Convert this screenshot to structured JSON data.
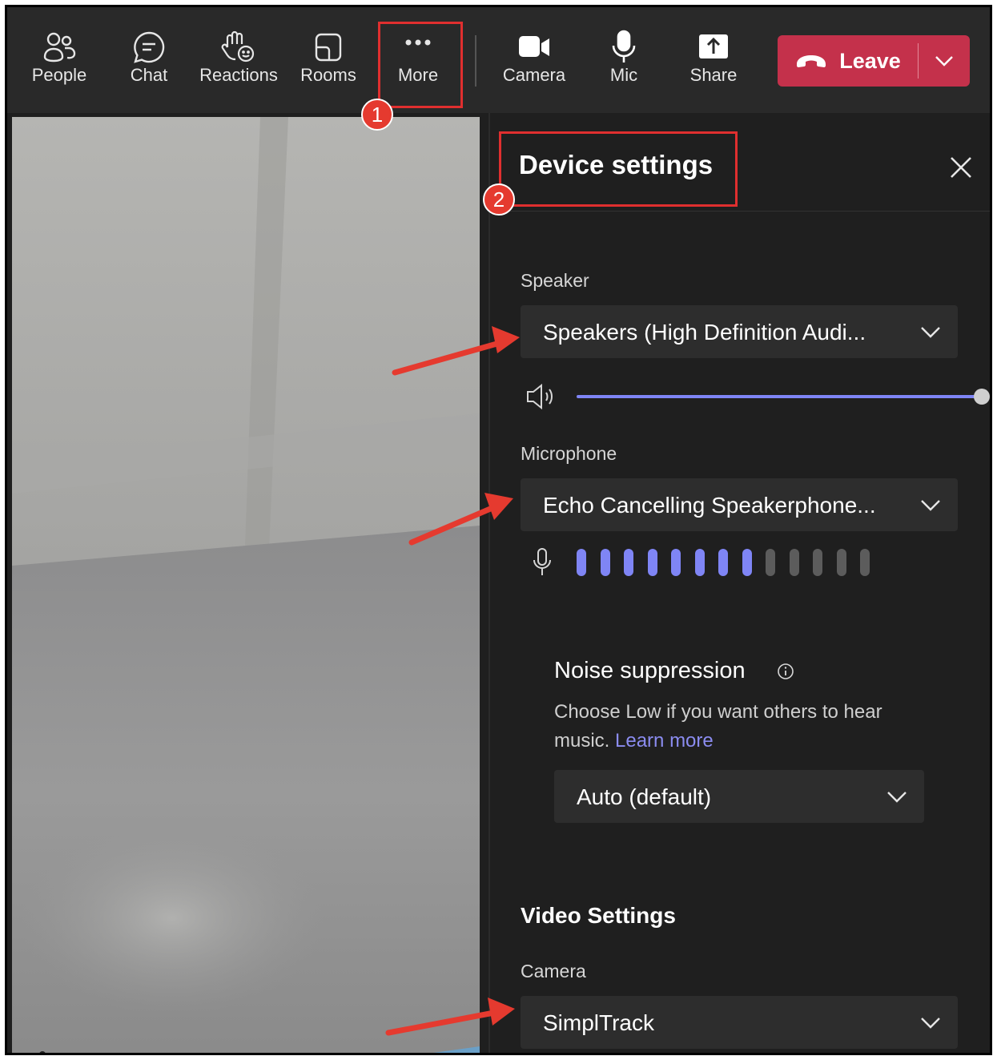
{
  "toolbar": {
    "people_label": "People",
    "chat_label": "Chat",
    "reactions_label": "Reactions",
    "rooms_label": "Rooms",
    "more_label": "More",
    "camera_label": "Camera",
    "mic_label": "Mic",
    "share_label": "Share",
    "leave_label": "Leave"
  },
  "panel": {
    "title": "Device settings",
    "speaker": {
      "label": "Speaker",
      "value": "Speakers (High Definition Audi...",
      "volume_fraction": 1.0
    },
    "microphone": {
      "label": "Microphone",
      "value": "Echo Cancelling Speakerphone...",
      "level_bars_active": 8,
      "level_bars_total": 13
    },
    "noise_suppression": {
      "title": "Noise suppression",
      "description": "Choose Low if you want others to hear music.",
      "learn_more": "Learn more",
      "value": "Auto (default)"
    },
    "video_settings": {
      "title": "Video Settings",
      "camera_label": "Camera",
      "camera_value": "SimplTrack"
    }
  },
  "annotations": {
    "badge_1": "1",
    "badge_2": "2"
  },
  "colors": {
    "accent": "#7f85f5",
    "leave": "#c4314b",
    "annotation": "#e53a2f",
    "mic_inactive": "#5c5c5c"
  }
}
